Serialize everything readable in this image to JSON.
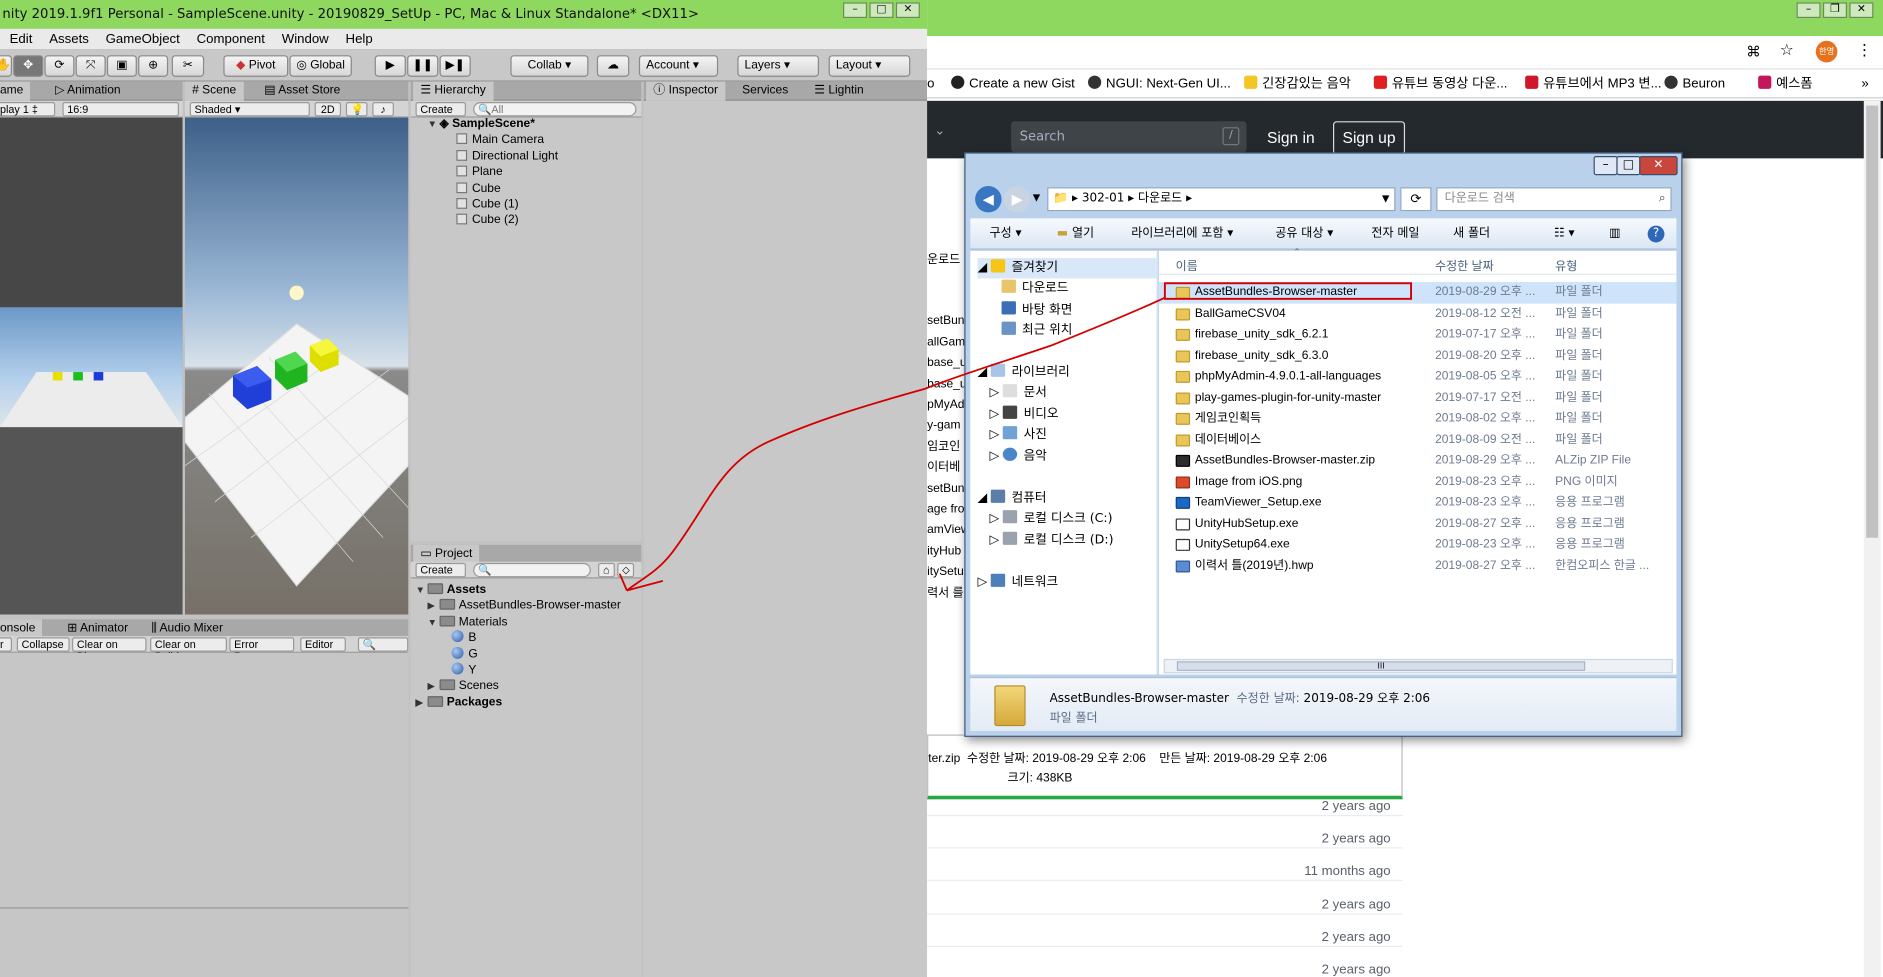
{
  "unity": {
    "title": "nity 2019.1.9f1 Personal - SampleScene.unity - 20190829_SetUp - PC, Mac & Linux Standalone* <DX11>",
    "menu": [
      "Edit",
      "Assets",
      "GameObject",
      "Component",
      "Window",
      "Help"
    ],
    "toolbar": {
      "pivot": "Pivot",
      "global": "Global",
      "collab": "Collab",
      "account": "Account",
      "layers": "Layers",
      "layout": "Layout"
    },
    "game_tabs": {
      "game": "ame",
      "animation": "Animation",
      "display": "play 1",
      "aspect": "16:9"
    },
    "scene_tabs": {
      "scene": "Scene",
      "asset_store": "Asset Store",
      "shaded": "Shaded",
      "twod": "2D"
    },
    "hierarchy": {
      "tab": "Hierarchy",
      "create": "Create",
      "search_placeholder": "All",
      "scene": "SampleScene*",
      "items": [
        "Main Camera",
        "Directional Light",
        "Plane",
        "Cube",
        "Cube (1)",
        "Cube (2)"
      ]
    },
    "inspector": {
      "tab": "Inspector",
      "services": "Services",
      "lighting": "Lightin"
    },
    "project": {
      "tab": "Project",
      "create": "Create",
      "assets": "Assets",
      "asset_bundles": "AssetBundles-Browser-master",
      "materials": "Materials",
      "materials_items": [
        "B",
        "G",
        "Y"
      ],
      "scenes": "Scenes",
      "packages": "Packages"
    },
    "console": {
      "tab": "onsole",
      "animator": "Animator",
      "audio_mixer": "Audio Mixer",
      "clear": "r",
      "collapse": "Collapse",
      "clear_on_play": "Clear on Play",
      "clear_on_build": "Clear on Build",
      "error_pause": "Error Pause",
      "editor": "Editor"
    }
  },
  "chrome": {
    "bookmarks": [
      "o",
      "Create a new Gist",
      "NGUI: Next-Gen UI...",
      "긴장감있는 음악",
      "유튜브 동영상 다운...",
      "유튜브에서 MP3 변...",
      "Beuron",
      "예스폼"
    ],
    "avatar": "한영",
    "github": {
      "search_placeholder": "Search",
      "slash": "/",
      "sign_in": "Sign in",
      "sign_up": "Sign up"
    },
    "partial_rows": [
      "운로드",
      "setBun",
      "allGame",
      "base_u",
      "base_u",
      "pMyAd",
      "y-gam",
      "임코인",
      "이터베",
      "setBun",
      "age fro",
      "amView",
      "ityHub",
      "itySetu",
      "력서 를"
    ],
    "download_item": {
      "name": "ter.zip",
      "modified_label": "수정한 날짜:",
      "modified": "2019-08-29 오후 2:06",
      "created_label": "만든 날짜:",
      "created": "2019-08-29 오후 2:06",
      "size_label": "크기:",
      "size": "438KB"
    },
    "ago": [
      "2 years ago",
      "2 years ago",
      "11 months ago",
      "2 years ago",
      "2 years ago",
      "2 years ago"
    ]
  },
  "explorer": {
    "path": [
      "302-01",
      "다운로드"
    ],
    "search_placeholder": "다운로드 검색",
    "commands": [
      "구성",
      "열기",
      "라이브러리에 포함",
      "공유 대상",
      "전자 메일",
      "새 폴더"
    ],
    "nav": {
      "favorites": "즐겨찾기",
      "downloads": "다운로드",
      "desktop": "바탕 화면",
      "recent": "최근 위치",
      "libraries": "라이브러리",
      "docs": "문서",
      "video": "비디오",
      "pictures": "사진",
      "music": "음악",
      "computer": "컴퓨터",
      "drive_c": "로컬 디스크 (C:)",
      "drive_d": "로컬 디스크 (D:)",
      "network": "네트워크"
    },
    "columns": {
      "name": "이름",
      "modified": "수정한 날짜",
      "type": "유형"
    },
    "files": [
      {
        "name": "AssetBundles-Browser-master",
        "date": "2019-08-29 오후 ...",
        "type": "파일 폴더",
        "icon": "folder-icon"
      },
      {
        "name": "BallGameCSV04",
        "date": "2019-08-12 오전 ...",
        "type": "파일 폴더",
        "icon": "folder-icon"
      },
      {
        "name": "firebase_unity_sdk_6.2.1",
        "date": "2019-07-17 오후 ...",
        "type": "파일 폴더",
        "icon": "folder-icon"
      },
      {
        "name": "firebase_unity_sdk_6.3.0",
        "date": "2019-08-20 오후 ...",
        "type": "파일 폴더",
        "icon": "folder-icon"
      },
      {
        "name": "phpMyAdmin-4.9.0.1-all-languages",
        "date": "2019-08-05 오후 ...",
        "type": "파일 폴더",
        "icon": "folder-icon"
      },
      {
        "name": "play-games-plugin-for-unity-master",
        "date": "2019-07-17 오전 ...",
        "type": "파일 폴더",
        "icon": "folder-icon"
      },
      {
        "name": "게임코인획득",
        "date": "2019-08-02 오후 ...",
        "type": "파일 폴더",
        "icon": "folder-icon"
      },
      {
        "name": "데이터베이스",
        "date": "2019-08-09 오전 ...",
        "type": "파일 폴더",
        "icon": "folder-icon"
      },
      {
        "name": "AssetBundles-Browser-master.zip",
        "date": "2019-08-29 오후 ...",
        "type": "ALZip ZIP File",
        "icon": "zip-icon"
      },
      {
        "name": "Image from iOS.png",
        "date": "2019-08-23 오후 ...",
        "type": "PNG 이미지",
        "icon": "image-icon"
      },
      {
        "name": "TeamViewer_Setup.exe",
        "date": "2019-08-23 오후 ...",
        "type": "응용 프로그램",
        "icon": "teamviewer-icon"
      },
      {
        "name": "UnityHubSetup.exe",
        "date": "2019-08-27 오후 ...",
        "type": "응용 프로그램",
        "icon": "unity-icon"
      },
      {
        "name": "UnitySetup64.exe",
        "date": "2019-08-23 오후 ...",
        "type": "응용 프로그램",
        "icon": "unity-icon"
      },
      {
        "name": "이력서 틀(2019년).hwp",
        "date": "2019-08-27 오후 ...",
        "type": "한컴오피스 한글 ...",
        "icon": "hwp-icon"
      }
    ],
    "status": {
      "name": "AssetBundles-Browser-master",
      "modified_label": "수정한 날짜:",
      "modified": "2019-08-29 오후 2:06",
      "type": "파일 폴더"
    },
    "scroll_grip": "III"
  },
  "colors": {
    "unity_titlebar": "#8fd85f",
    "github_header": "#24292e",
    "highlight": "#cfe3fa",
    "annotation": "#d40000"
  }
}
